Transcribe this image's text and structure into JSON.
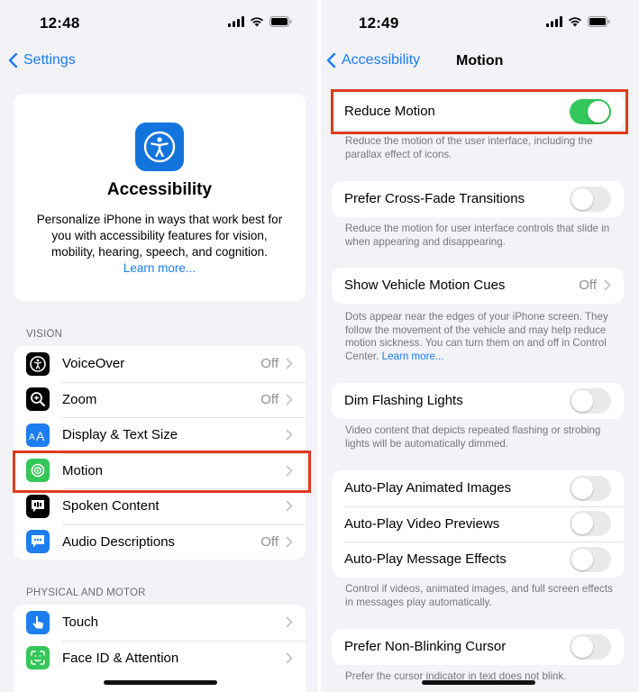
{
  "left": {
    "status": {
      "time": "12:48"
    },
    "nav": {
      "back_label": "Settings"
    },
    "hero": {
      "title": "Accessibility",
      "description": "Personalize iPhone in ways that work best for you with accessibility features for vision, mobility, hearing, speech, and cognition.",
      "link": "Learn more..."
    },
    "vision_header": "VISION",
    "vision_items": [
      {
        "label": "VoiceOver",
        "value": "Off",
        "icon": "voiceover-icon"
      },
      {
        "label": "Zoom",
        "value": "Off",
        "icon": "zoom-icon"
      },
      {
        "label": "Display & Text Size",
        "value": "",
        "icon": "display-text-size-icon"
      },
      {
        "label": "Motion",
        "value": "",
        "icon": "motion-icon"
      },
      {
        "label": "Spoken Content",
        "value": "",
        "icon": "spoken-content-icon"
      },
      {
        "label": "Audio Descriptions",
        "value": "Off",
        "icon": "audio-descriptions-icon"
      }
    ],
    "physical_header": "PHYSICAL AND MOTOR",
    "physical_items": [
      {
        "label": "Touch",
        "value": "",
        "icon": "touch-icon"
      },
      {
        "label": "Face ID & Attention",
        "value": "",
        "icon": "face-id-icon"
      }
    ]
  },
  "right": {
    "status": {
      "time": "12:49"
    },
    "nav": {
      "back_label": "Accessibility",
      "title": "Motion"
    },
    "reduce_motion": {
      "label": "Reduce Motion",
      "on": true,
      "footer": "Reduce the motion of the user interface, including the parallax effect of icons."
    },
    "cross_fade": {
      "label": "Prefer Cross-Fade Transitions",
      "on": false,
      "footer": "Reduce the motion for user interface controls that slide in when appearing and disappearing."
    },
    "vehicle_cues": {
      "label": "Show Vehicle Motion Cues",
      "value": "Off",
      "footer": "Dots appear near the edges of your iPhone screen. They follow the movement of the vehicle and may help reduce motion sickness. You can turn them on and off in Control Center.",
      "footer_link": "Learn more..."
    },
    "dim_flashing": {
      "label": "Dim Flashing Lights",
      "on": false,
      "footer": "Video content that depicts repeated flashing or strobing lights will be automatically dimmed."
    },
    "autoplay": {
      "items": [
        {
          "label": "Auto-Play Animated Images",
          "on": false
        },
        {
          "label": "Auto-Play Video Previews",
          "on": false
        },
        {
          "label": "Auto-Play Message Effects",
          "on": false
        }
      ],
      "footer": "Control if videos, animated images, and full screen effects in messages play automatically."
    },
    "non_blinking": {
      "label": "Prefer Non-Blinking Cursor",
      "on": false,
      "footer": "Prefer the cursor indicator in text does not blink."
    }
  },
  "colors": {
    "accent_blue": "#1a7cf4",
    "toggle_on_green": "#34c759",
    "highlight_red": "#dd3c1e",
    "grouped_background": "#f2f2f7"
  }
}
